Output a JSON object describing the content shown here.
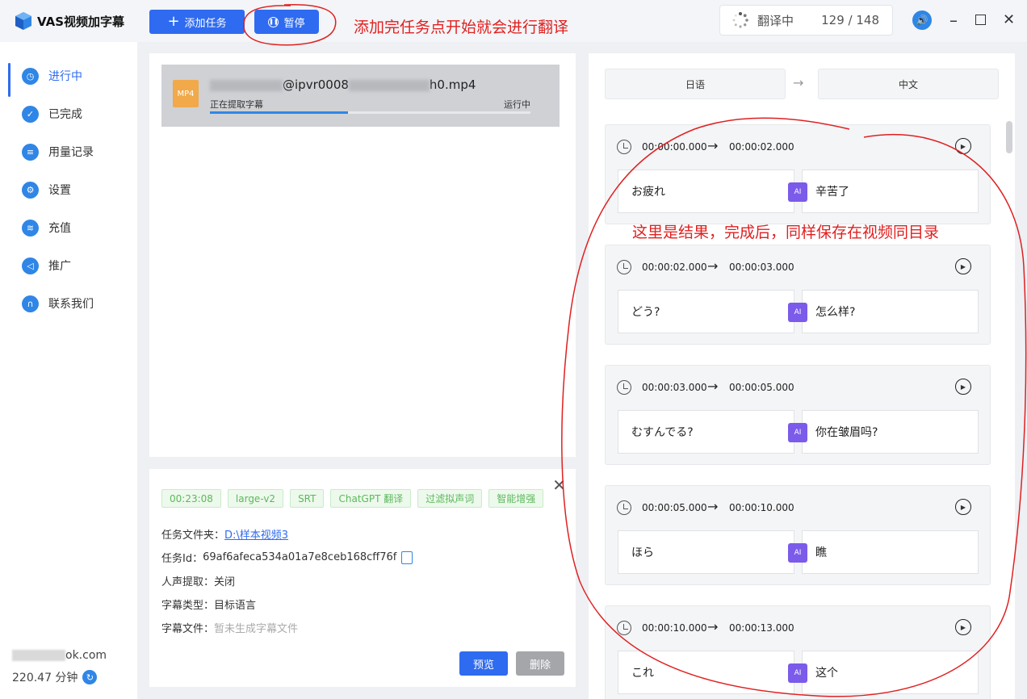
{
  "app": {
    "title": "VAS视频加字幕"
  },
  "toolbar": {
    "add_label": "添加任务",
    "pause_label": "暂停"
  },
  "annotations": {
    "top": "添加完任务点开始就会进行翻译",
    "result": "这里是结果，完成后，同样保存在视频同目录"
  },
  "status": {
    "label": "翻译中",
    "count": "129 / 148"
  },
  "sidebar": {
    "items": [
      {
        "label": "进行中",
        "icon": "clock-icon",
        "active": true
      },
      {
        "label": "已完成",
        "icon": "check-icon"
      },
      {
        "label": "用量记录",
        "icon": "list-icon"
      },
      {
        "label": "设置",
        "icon": "gear-icon"
      },
      {
        "label": "充值",
        "icon": "coins-icon"
      },
      {
        "label": "推广",
        "icon": "megaphone-icon"
      },
      {
        "label": "联系我们",
        "icon": "headset-icon"
      }
    ],
    "account_suffix": "ok.com",
    "minutes": "220.47 分钟"
  },
  "task": {
    "file_icon": "MP4",
    "name_mid": "@ipvr0008",
    "name_end": "h0.mp4",
    "status": "正在提取字幕",
    "state": "运行中",
    "progress": 0.43
  },
  "detail": {
    "tags": [
      "00:23:08",
      "large-v2",
      "SRT",
      "ChatGPT 翻译",
      "过滤拟声词",
      "智能增强"
    ],
    "folder_key": "任务文件夹：",
    "folder_value": "D:\\样本视频3",
    "id_key": "任务Id：",
    "id_value": "69af6afeca534a01a7e8ceb168cff76f",
    "voice_key": "人声提取：",
    "voice_value": "关闭",
    "subtype_key": "字幕类型：",
    "subtype_value": "目标语言",
    "subfile_key": "字幕文件：",
    "subfile_value": "暂未生成字幕文件",
    "preview_label": "预览",
    "delete_label": "删除"
  },
  "result": {
    "source_lang": "日语",
    "target_lang": "中文",
    "segments": [
      {
        "start": "00:00:00.000",
        "end": "00:00:02.000",
        "src": "お疲れ",
        "dst": "辛苦了"
      },
      {
        "start": "00:00:02.000",
        "end": "00:00:03.000",
        "src": "どう?",
        "dst": "怎么样?"
      },
      {
        "start": "00:00:03.000",
        "end": "00:00:05.000",
        "src": "むすんでる?",
        "dst": "你在皱眉吗?"
      },
      {
        "start": "00:00:05.000",
        "end": "00:00:10.000",
        "src": "ほら",
        "dst": "瞧"
      },
      {
        "start": "00:00:10.000",
        "end": "00:00:13.000",
        "src": "これ",
        "dst": "这个"
      }
    ]
  }
}
